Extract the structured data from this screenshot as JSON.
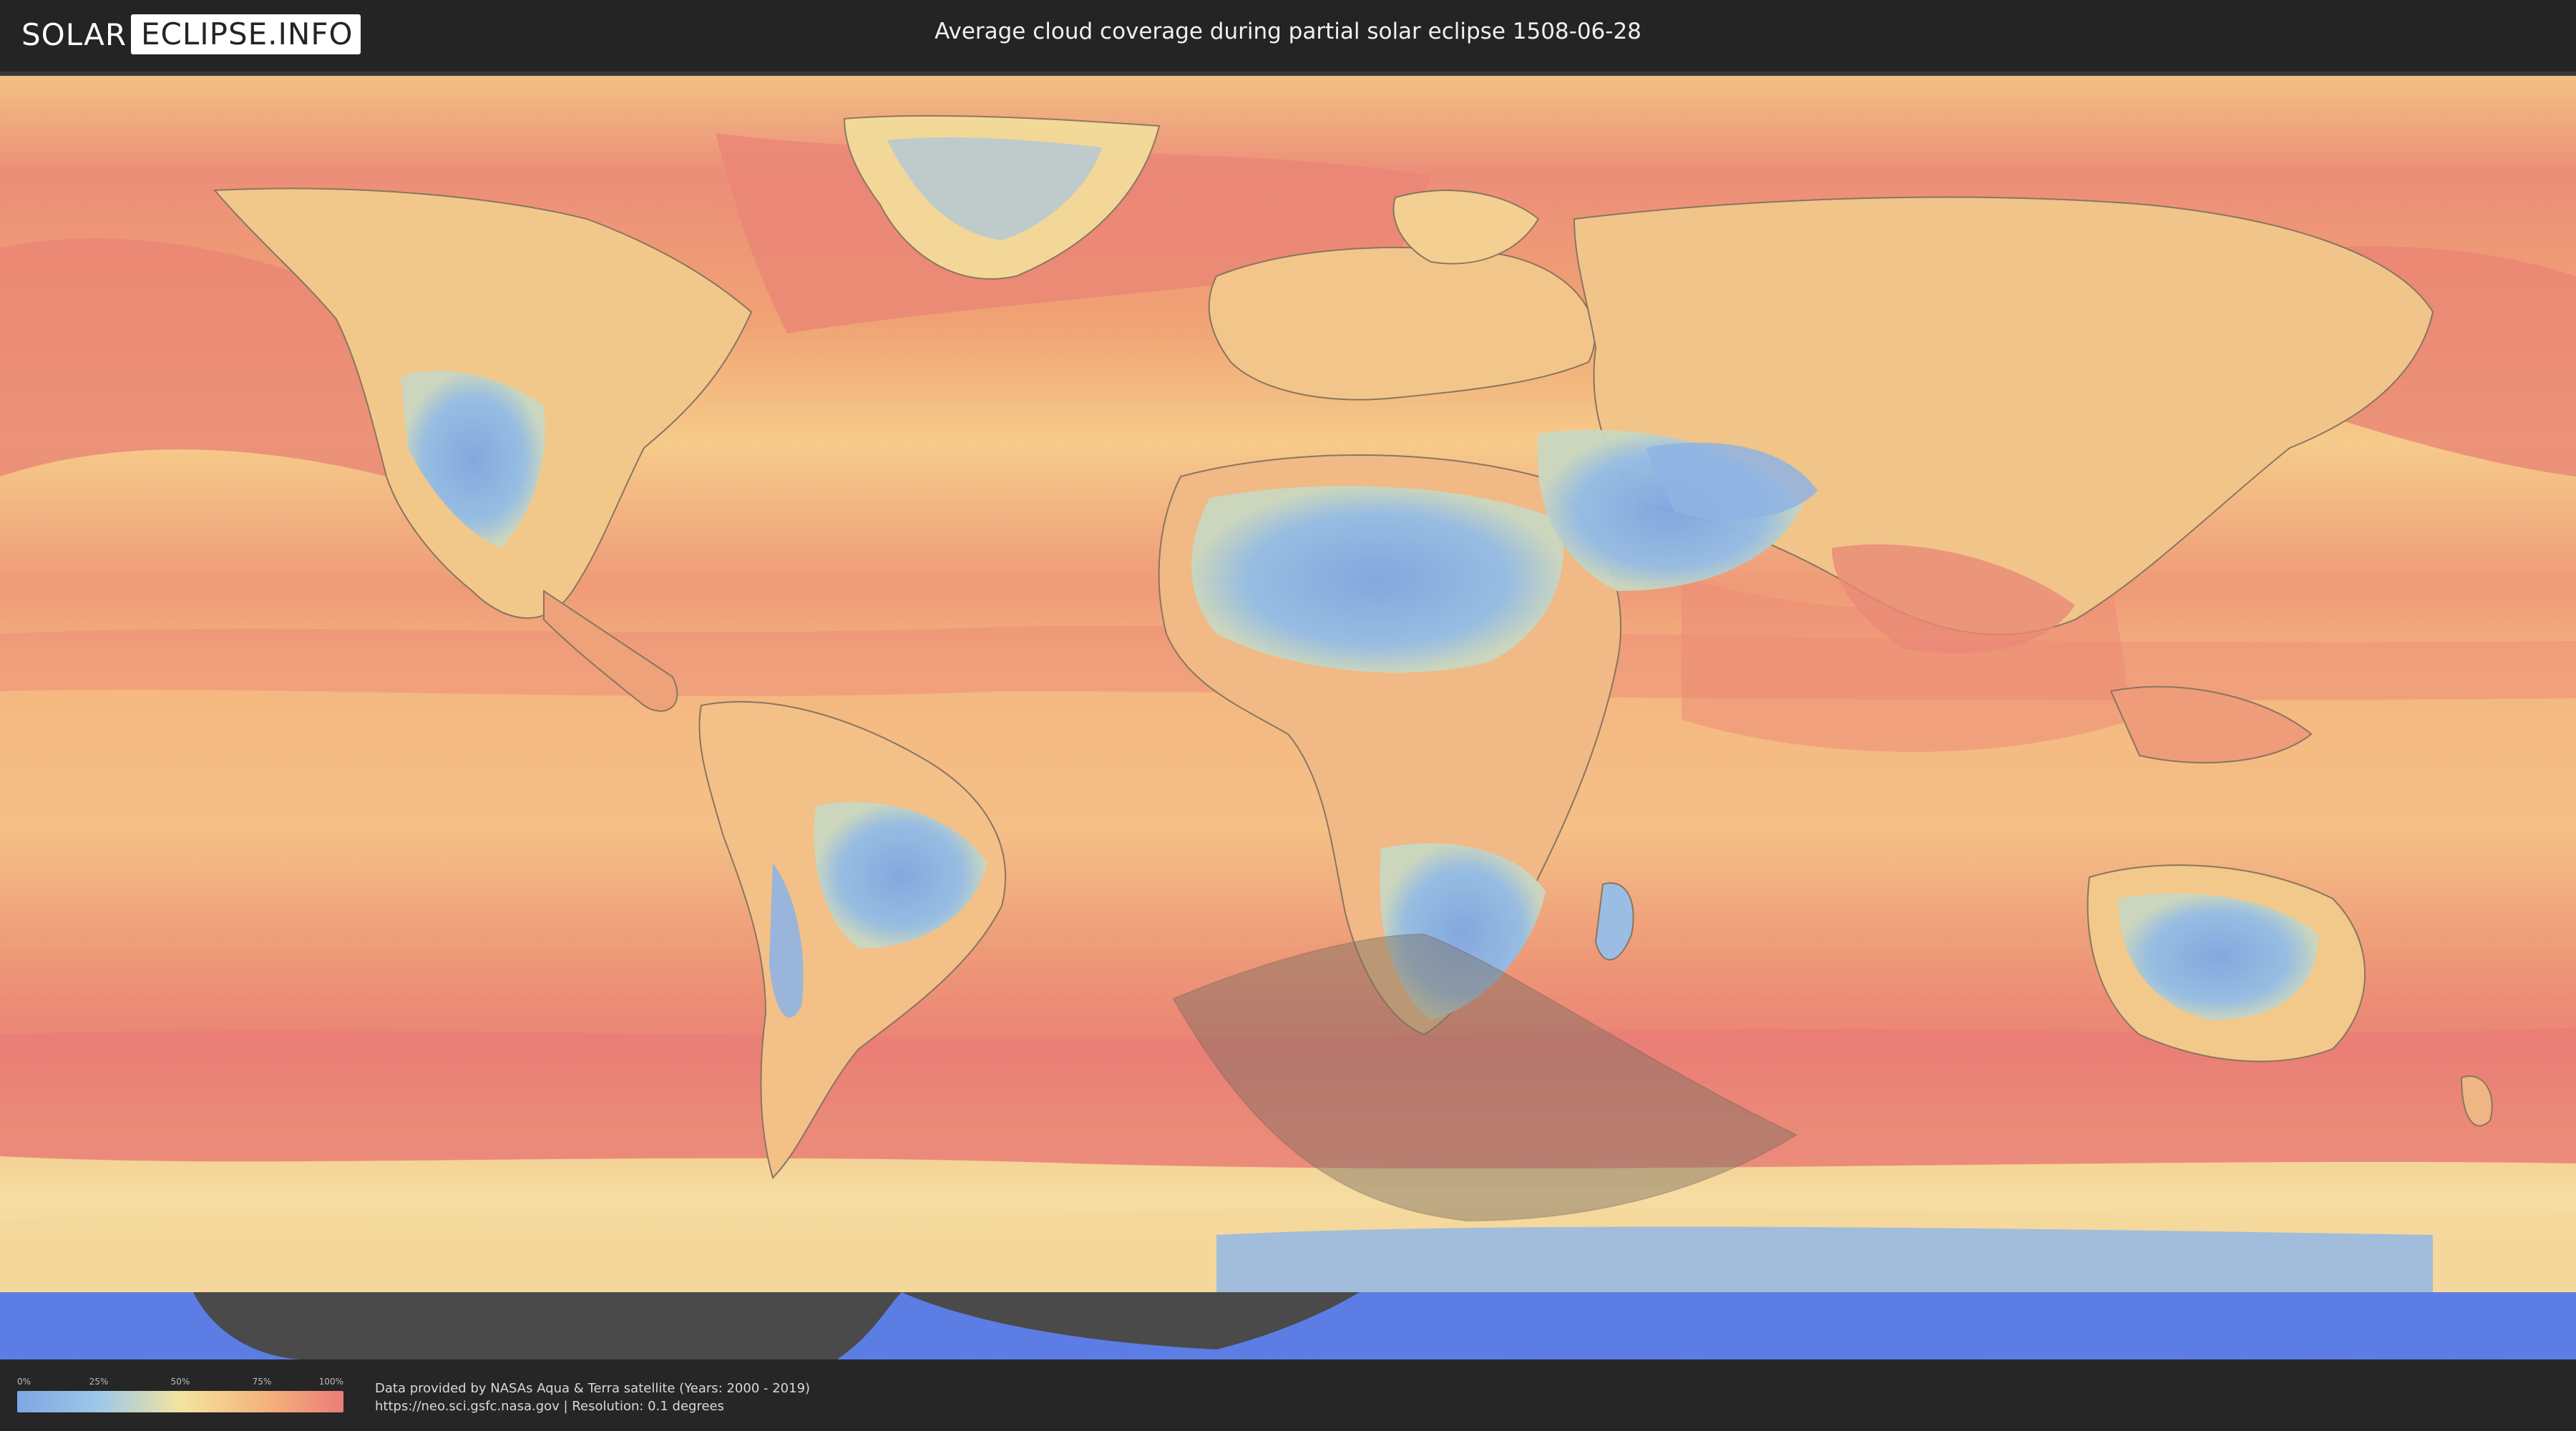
{
  "header": {
    "logo_left": "SOLAR",
    "logo_right": "ECLIPSE.INFO",
    "title": "Average cloud coverage during partial solar eclipse 1508-06-28"
  },
  "map": {
    "description_icon": "world-map",
    "colors": {
      "ocean_cloudy": "#e88a78",
      "ocean_mid": "#f0a878",
      "clear_sky": "#7ea6e3",
      "antarctic_ice": "#5b7de4",
      "eclipse_shadow": "#7b6f63"
    }
  },
  "legend": {
    "ticks": [
      "0%",
      "25%",
      "50%",
      "75%",
      "100%"
    ],
    "gradient": [
      "#7ea6e3",
      "#9dc8e8",
      "#f2e4a0",
      "#f5b57c",
      "#eb7d78"
    ]
  },
  "footer": {
    "credit_line1": "Data provided by NASAs Aqua & Terra satellite (Years: 2000 - 2019)",
    "credit_line2": "https://neo.sci.gsfc.nasa.gov | Resolution: 0.1 degrees"
  }
}
